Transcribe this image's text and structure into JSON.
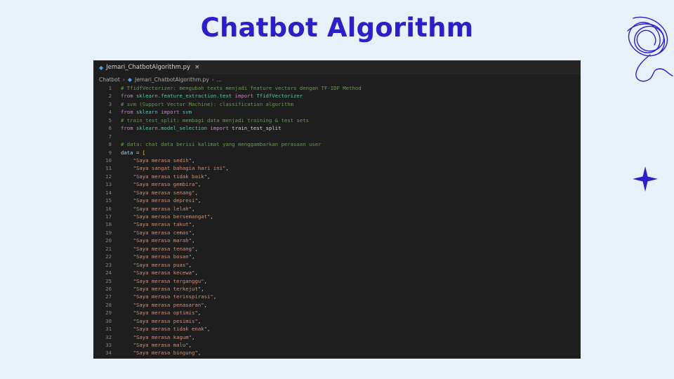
{
  "slide": {
    "title": "Chatbot Algorithm"
  },
  "editor": {
    "tab": {
      "filename": "Jemari_ChatbotAlgorithm.py",
      "close": "×"
    },
    "breadcrumb": {
      "folder": "Chatbot",
      "file": "Jemari_ChatbotAlgorithm.py",
      "more": "..."
    },
    "lines": [
      {
        "n": "1",
        "tokens": [
          [
            "comment",
            "# TfidfVectorizer: mengubah texts menjadi feature vectors dengan TF-IDF Method"
          ]
        ]
      },
      {
        "n": "2",
        "tokens": [
          [
            "keyword",
            "from "
          ],
          [
            "module",
            "sklearn.feature_extraction.text"
          ],
          [
            "keyword",
            " import "
          ],
          [
            "module",
            "TfidfVectorizer"
          ]
        ]
      },
      {
        "n": "3",
        "tokens": [
          [
            "comment",
            "# svm (Support Vector Machine): classification algorithm"
          ]
        ]
      },
      {
        "n": "4",
        "tokens": [
          [
            "keyword",
            "from "
          ],
          [
            "module",
            "sklearn"
          ],
          [
            "keyword",
            " import "
          ],
          [
            "module",
            "svm"
          ]
        ]
      },
      {
        "n": "5",
        "tokens": [
          [
            "comment",
            "# train_test_split: membagi data menjadi training & test sets"
          ]
        ]
      },
      {
        "n": "6",
        "tokens": [
          [
            "keyword",
            "from "
          ],
          [
            "module",
            "sklearn.model_selection"
          ],
          [
            "keyword",
            " import "
          ],
          [
            "plain",
            "train_test_split"
          ]
        ]
      },
      {
        "n": "7",
        "tokens": []
      },
      {
        "n": "8",
        "tokens": [
          [
            "comment",
            "# data: chat data berisi kalimat yang menggambarkan perasaan user"
          ]
        ]
      },
      {
        "n": "9",
        "tokens": [
          [
            "var",
            "data"
          ],
          [
            "plain",
            " = "
          ],
          [
            "bracket",
            "["
          ]
        ]
      },
      {
        "n": "10",
        "tokens": [
          [
            "plain",
            "    "
          ],
          [
            "string",
            "\"Saya merasa sedih\""
          ],
          [
            "plain",
            ","
          ]
        ]
      },
      {
        "n": "11",
        "tokens": [
          [
            "plain",
            "    "
          ],
          [
            "string",
            "\"Saya sangat bahagia hari ini\""
          ],
          [
            "plain",
            ","
          ]
        ]
      },
      {
        "n": "12",
        "tokens": [
          [
            "plain",
            "    "
          ],
          [
            "string",
            "\"Saya merasa tidak baik\""
          ],
          [
            "plain",
            ","
          ]
        ]
      },
      {
        "n": "13",
        "tokens": [
          [
            "plain",
            "    "
          ],
          [
            "string",
            "\"Saya merasa gembira\""
          ],
          [
            "plain",
            ","
          ]
        ]
      },
      {
        "n": "14",
        "tokens": [
          [
            "plain",
            "    "
          ],
          [
            "string",
            "\"Saya merasa senang\""
          ],
          [
            "plain",
            ","
          ]
        ]
      },
      {
        "n": "15",
        "tokens": [
          [
            "plain",
            "    "
          ],
          [
            "string",
            "\"Saya merasa depresi\""
          ],
          [
            "plain",
            ","
          ]
        ]
      },
      {
        "n": "16",
        "tokens": [
          [
            "plain",
            "    "
          ],
          [
            "string",
            "\"Saya merasa lelah\""
          ],
          [
            "plain",
            ","
          ]
        ]
      },
      {
        "n": "17",
        "tokens": [
          [
            "plain",
            "    "
          ],
          [
            "string",
            "\"Saya merasa bersemangat\""
          ],
          [
            "plain",
            ","
          ]
        ]
      },
      {
        "n": "18",
        "tokens": [
          [
            "plain",
            "    "
          ],
          [
            "string",
            "\"Saya merasa takut\""
          ],
          [
            "plain",
            ","
          ]
        ]
      },
      {
        "n": "19",
        "tokens": [
          [
            "plain",
            "    "
          ],
          [
            "string",
            "\"Saya merasa cemas\""
          ],
          [
            "plain",
            ","
          ]
        ]
      },
      {
        "n": "20",
        "tokens": [
          [
            "plain",
            "    "
          ],
          [
            "string",
            "\"Saya merasa marah\""
          ],
          [
            "plain",
            ","
          ]
        ]
      },
      {
        "n": "21",
        "tokens": [
          [
            "plain",
            "    "
          ],
          [
            "string",
            "\"Saya merasa tenang\""
          ],
          [
            "plain",
            ","
          ]
        ]
      },
      {
        "n": "22",
        "tokens": [
          [
            "plain",
            "    "
          ],
          [
            "string",
            "\"Saya merasa bosan\""
          ],
          [
            "plain",
            ","
          ]
        ]
      },
      {
        "n": "23",
        "tokens": [
          [
            "plain",
            "    "
          ],
          [
            "string",
            "\"Saya merasa puas\""
          ],
          [
            "plain",
            ","
          ]
        ]
      },
      {
        "n": "24",
        "tokens": [
          [
            "plain",
            "    "
          ],
          [
            "string",
            "\"Saya merasa kecewa\""
          ],
          [
            "plain",
            ","
          ]
        ]
      },
      {
        "n": "25",
        "tokens": [
          [
            "plain",
            "    "
          ],
          [
            "string",
            "\"Saya merasa terganggu\""
          ],
          [
            "plain",
            ","
          ]
        ]
      },
      {
        "n": "26",
        "tokens": [
          [
            "plain",
            "    "
          ],
          [
            "string",
            "\"Saya merasa terkejut\""
          ],
          [
            "plain",
            ","
          ]
        ]
      },
      {
        "n": "27",
        "tokens": [
          [
            "plain",
            "    "
          ],
          [
            "string",
            "\"Saya merasa terinspirasi\""
          ],
          [
            "plain",
            ","
          ]
        ]
      },
      {
        "n": "28",
        "tokens": [
          [
            "plain",
            "    "
          ],
          [
            "string",
            "\"Saya merasa penasaran\""
          ],
          [
            "plain",
            ","
          ]
        ]
      },
      {
        "n": "29",
        "tokens": [
          [
            "plain",
            "    "
          ],
          [
            "string",
            "\"Saya merasa optimis\""
          ],
          [
            "plain",
            ","
          ]
        ]
      },
      {
        "n": "30",
        "tokens": [
          [
            "plain",
            "    "
          ],
          [
            "string",
            "\"Saya merasa pesimis\""
          ],
          [
            "plain",
            ","
          ]
        ]
      },
      {
        "n": "31",
        "tokens": [
          [
            "plain",
            "    "
          ],
          [
            "string",
            "\"Saya merasa tidak enak\""
          ],
          [
            "plain",
            ","
          ]
        ]
      },
      {
        "n": "32",
        "tokens": [
          [
            "plain",
            "    "
          ],
          [
            "string",
            "\"Saya merasa kagum\""
          ],
          [
            "plain",
            ","
          ]
        ]
      },
      {
        "n": "33",
        "tokens": [
          [
            "plain",
            "    "
          ],
          [
            "string",
            "\"Saya merasa malu\""
          ],
          [
            "plain",
            ","
          ]
        ]
      },
      {
        "n": "34",
        "tokens": [
          [
            "plain",
            "    "
          ],
          [
            "string",
            "\"Saya merasa bingung\""
          ],
          [
            "plain",
            ","
          ]
        ]
      }
    ]
  },
  "decorations": {
    "scribble": "scribble-doodle",
    "sparkle": "four-point-star",
    "accent_color": "#2b1fc7"
  }
}
